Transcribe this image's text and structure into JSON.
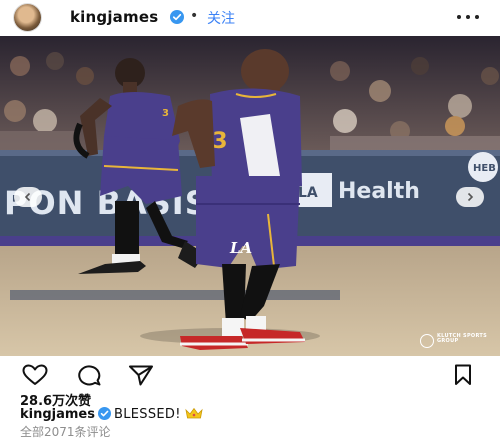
{
  "post": {
    "username": "kingjames",
    "dot": "•",
    "follow_label": "关注",
    "avatar_icon": "profile-avatar",
    "more_icon": "more-horizontal-icon"
  },
  "photo": {
    "jersey_numbers": [
      "23",
      "3"
    ],
    "board_text": "PON  BASIS",
    "board_health": "Health",
    "board_brand": "LA",
    "wheel_text": "HEB",
    "shorts_logo": "LA",
    "watermark": "KLUTCH SPORTS GROUP",
    "colors": {
      "lakers_purple": "#4a3f8c",
      "lakers_gold": "#e8b53a",
      "board": "#3f4f6a",
      "floor": "#c9b89a"
    }
  },
  "actions": {
    "like_icon": "heart-icon",
    "comment_icon": "comment-icon",
    "share_icon": "send-icon",
    "save_icon": "bookmark-icon"
  },
  "likes_text": "28.6万次赞",
  "caption": {
    "username": "kingjames",
    "text": "BLESSED!",
    "emoji": "crown"
  },
  "comments_text": "全部2071条评论"
}
